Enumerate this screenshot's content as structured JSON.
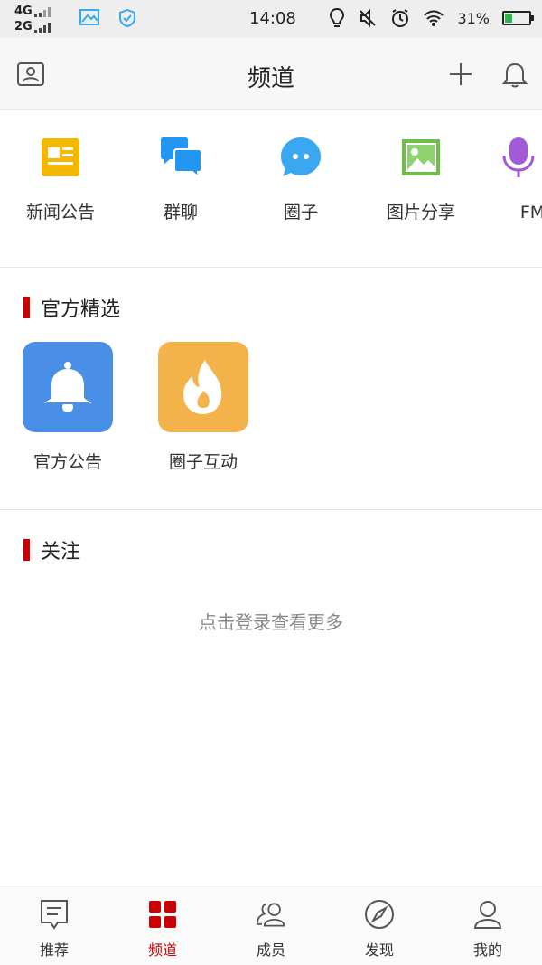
{
  "status_bar": {
    "network_top": "4G",
    "network_bottom": "2G",
    "time": "14:08",
    "battery_text": "31%",
    "battery_level": 0.31
  },
  "header": {
    "title": "频道"
  },
  "channels": [
    {
      "label": "新闻公告",
      "icon": "news-icon",
      "color": "#f5b800"
    },
    {
      "label": "群聊",
      "icon": "chat-bubbles-icon",
      "color": "#2196f3"
    },
    {
      "label": "圈子",
      "icon": "circle-chat-icon",
      "color": "#3aa8f0"
    },
    {
      "label": "图片分享",
      "icon": "image-icon",
      "color": "#6cc04a"
    },
    {
      "label": "FM频",
      "icon": "microphone-icon",
      "color": "#a35ad6"
    }
  ],
  "official": {
    "title": "官方精选",
    "items": [
      {
        "label": "官方公告",
        "icon": "bell-icon",
        "color": "#4a8fe7"
      },
      {
        "label": "圈子互动",
        "icon": "flame-icon",
        "color": "#f4b34a"
      }
    ]
  },
  "follow": {
    "title": "关注",
    "hint": "点击登录查看更多"
  },
  "bottom_nav": [
    {
      "label": "推荐",
      "icon": "recommend-icon",
      "active": false
    },
    {
      "label": "频道",
      "icon": "channels-grid-icon",
      "active": true
    },
    {
      "label": "成员",
      "icon": "members-icon",
      "active": false
    },
    {
      "label": "发现",
      "icon": "compass-icon",
      "active": false
    },
    {
      "label": "我的",
      "icon": "profile-icon",
      "active": false
    }
  ],
  "colors": {
    "accent": "#cc0000"
  }
}
